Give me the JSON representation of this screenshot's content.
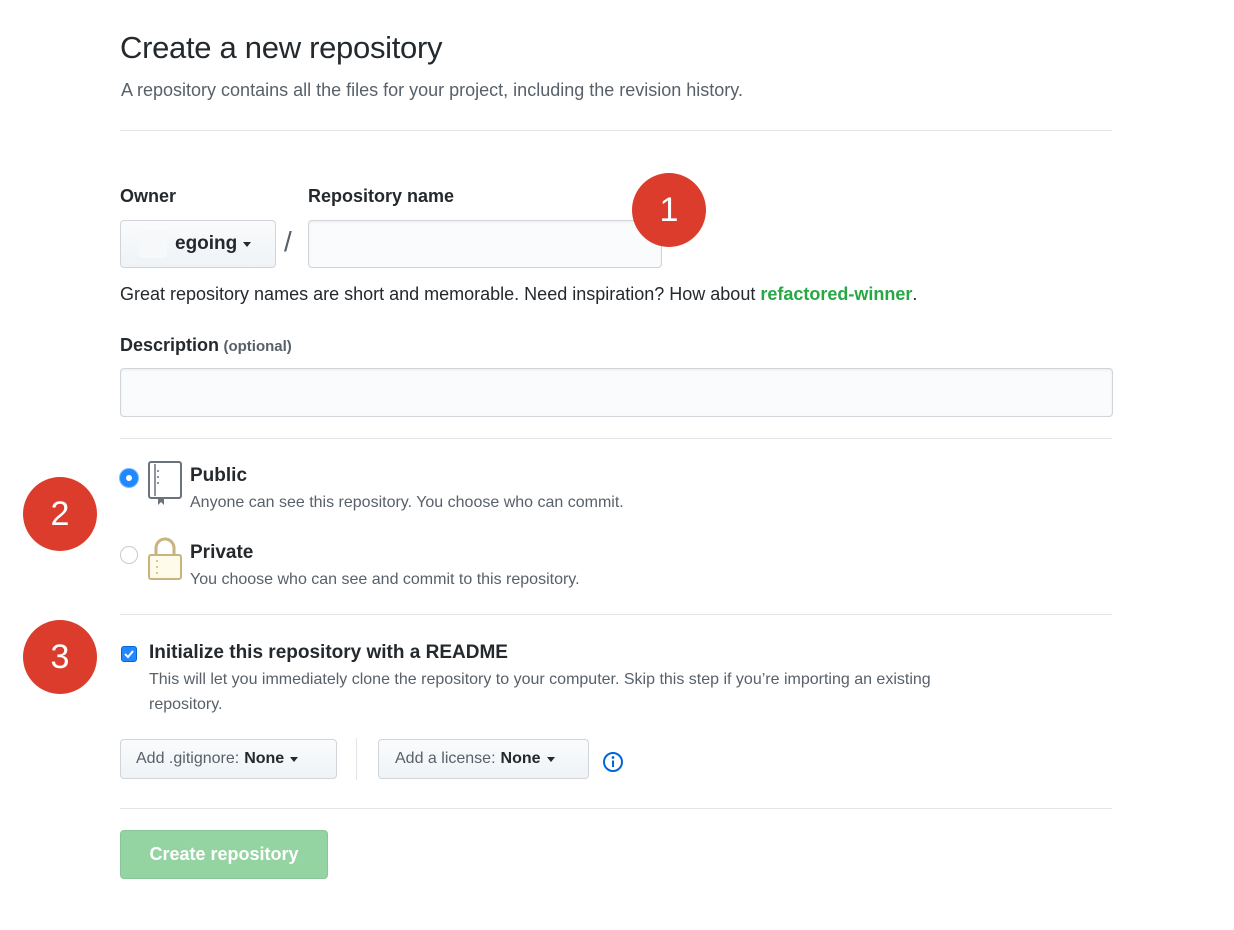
{
  "page": {
    "title": "Create a new repository",
    "subtitle": "A repository contains all the files for your project, including the revision history."
  },
  "owner": {
    "label": "Owner",
    "value": "egoing"
  },
  "slash": "/",
  "repo_name": {
    "label": "Repository name",
    "value": "",
    "hint_prefix": "Great repository names are short and memorable. Need inspiration? How about ",
    "suggestion": "refactored-winner",
    "hint_suffix": "."
  },
  "description": {
    "label": "Description",
    "optional": "(optional)",
    "value": ""
  },
  "visibility": {
    "selected": "public",
    "public": {
      "title": "Public",
      "desc": "Anyone can see this repository. You choose who can commit."
    },
    "private": {
      "title": "Private",
      "desc": "You choose who can see and commit to this repository."
    }
  },
  "readme": {
    "checked": true,
    "title": "Initialize this repository with a README",
    "desc_line1": "This will let you immediately clone the repository to your computer. Skip this step if you’re importing an existing",
    "desc_line2": "repository."
  },
  "gitignore": {
    "label": "Add .gitignore:",
    "value": "None"
  },
  "license": {
    "label": "Add a license:",
    "value": "None"
  },
  "create_button": "Create repository",
  "callouts": [
    "1",
    "2",
    "3"
  ],
  "colors": {
    "suggestion": "#28a745",
    "callout": "#db3c2c",
    "create_disabled": "#94d3a2",
    "accent": "#2188ff"
  },
  "icons": [
    "caret-down-icon",
    "repo-icon",
    "lock-icon",
    "checkmark-icon",
    "info-icon"
  ]
}
